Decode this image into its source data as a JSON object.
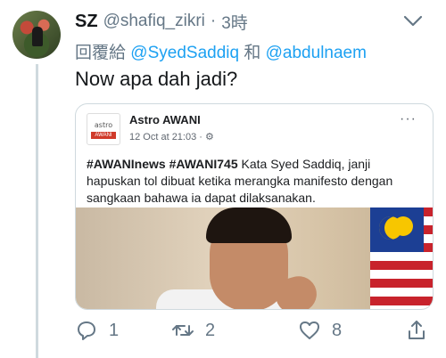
{
  "tweet": {
    "author_name": "SZ",
    "author_handle": "@shafiq_zikri",
    "separator": "·",
    "time": "3時",
    "replying_prefix": "回覆給",
    "mention_1": "@SyedSaddiq",
    "conjunction": "和",
    "mention_2": "@abdulnaem",
    "text": "Now apa dah jadi?"
  },
  "quoted_post": {
    "logo_top": "astro",
    "logo_bar": "AWANI",
    "page_name": "Astro AWANI",
    "meta": "12 Oct at 21:03 · ⚙",
    "more": "···",
    "hashtags": "#AWANInews #AWANI745",
    "body": " Kata Syed Saddiq, janji hapuskan tol dibuat ketika merangka manifesto dengan sangkaan bahawa ia dapat dilaksanakan."
  },
  "actions": {
    "reply_count": "1",
    "retweet_count": "2",
    "like_count": "8"
  },
  "icons": [
    "chevron-down-icon",
    "reply-icon",
    "retweet-icon",
    "like-icon",
    "share-icon"
  ],
  "colors": {
    "link": "#1da1f2",
    "secondary": "#657786",
    "thread_line": "#cfd9de"
  }
}
